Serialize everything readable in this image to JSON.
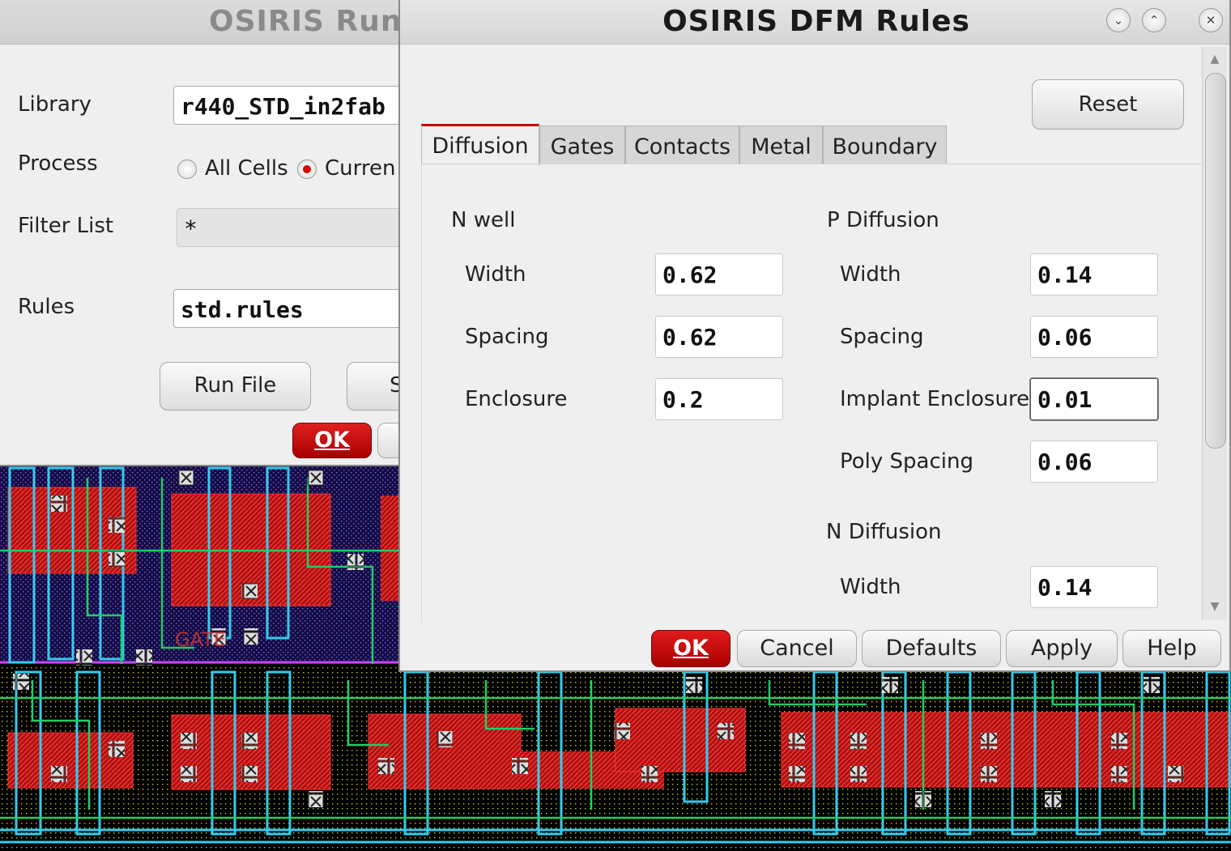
{
  "run_window": {
    "title": "OSIRIS Run",
    "library_label": "Library",
    "library_value": "r440_STD_in2fab",
    "process_label": "Process",
    "process_options": [
      "All Cells",
      "Curren"
    ],
    "process_selected": "Curren",
    "filter_label": "Filter List",
    "filter_value": "*",
    "rules_label": "Rules",
    "rules_value": "std.rules",
    "run_file_button": "Run File",
    "partial_button": "S",
    "ok_button": "OK"
  },
  "dfm_window": {
    "title": "OSIRIS DFM Rules",
    "reset_button": "Reset",
    "tabs": [
      "Diffusion",
      "Gates",
      "Contacts",
      "Metal",
      "Boundary"
    ],
    "active_tab": "Diffusion",
    "n_well": {
      "heading": "N well",
      "width_label": "Width",
      "width_value": "0.62",
      "spacing_label": "Spacing",
      "spacing_value": "0.62",
      "enclosure_label": "Enclosure",
      "enclosure_value": "0.2"
    },
    "p_diffusion": {
      "heading": "P Diffusion",
      "width_label": "Width",
      "width_value": "0.14",
      "spacing_label": "Spacing",
      "spacing_value": "0.06",
      "implant_label": "Implant Enclosure",
      "implant_value": "0.01",
      "poly_label": "Poly Spacing",
      "poly_value": "0.06"
    },
    "n_diffusion": {
      "heading": "N Diffusion",
      "width_label": "Width",
      "width_value": "0.14"
    },
    "buttons": {
      "ok": "OK",
      "cancel": "Cancel",
      "defaults": "Defaults",
      "apply": "Apply",
      "help": "Help"
    }
  },
  "layout_canvas": {
    "gate_label": "GATE",
    "colors": {
      "background": "#000000",
      "diffusion": "#cc1111",
      "metal": "#33ccee",
      "poly": "#22cc66",
      "boundary": "#cc44ff",
      "dots": "#cccc33"
    }
  }
}
